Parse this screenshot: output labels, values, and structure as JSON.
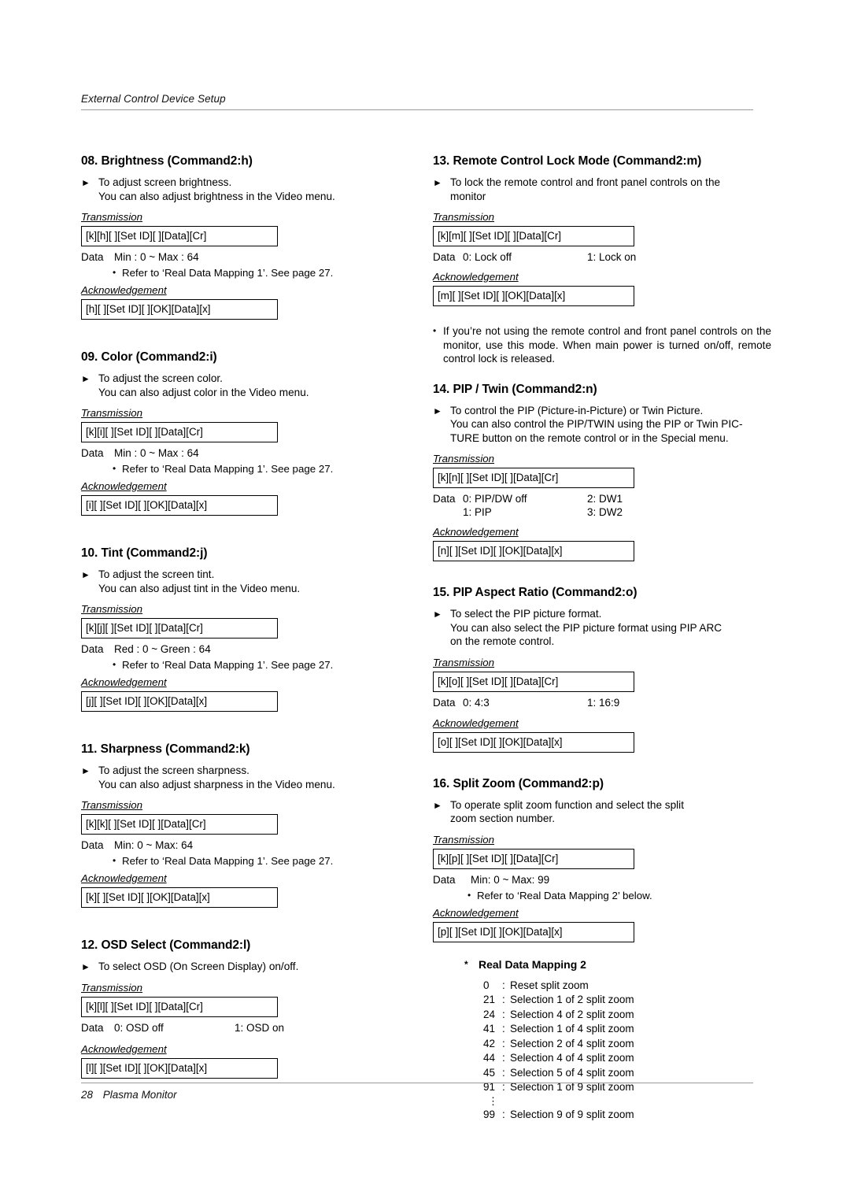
{
  "header": {
    "title": "External Control Device Setup"
  },
  "footer": {
    "page_number": "28",
    "product": "Plasma Monitor"
  },
  "labels": {
    "transmission": "Transmission",
    "acknowledgement": "Acknowledgement",
    "data": "Data",
    "arrow_icon": "black-right-triangle",
    "bullet_icon": "round-bullet",
    "star_icon": "asterisk"
  },
  "left_column": [
    {
      "id": "08",
      "title": "08. Brightness (Command2:h)",
      "desc_lines": [
        "To adjust screen brightness.",
        "You can also adjust brightness in the Video menu."
      ],
      "transmission": "[k][h][  ][Set ID][  ][Data][Cr]",
      "data_label": "Data",
      "data_v1": "Min : 0 ~ Max : 64",
      "data_v2": "",
      "ref": "Refer to ‘Real Data Mapping 1’. See page 27.",
      "acknowledgement": "[h][  ][Set ID][  ][OK][Data][x]"
    },
    {
      "id": "09",
      "title": "09. Color (Command2:i)",
      "desc_lines": [
        "To adjust the screen color.",
        "You can also adjust color in the Video menu."
      ],
      "transmission": "[k][i][  ][Set ID][  ][Data][Cr]",
      "data_label": "Data",
      "data_v1": "Min : 0 ~ Max : 64",
      "data_v2": "",
      "ref": "Refer to ‘Real Data Mapping 1’. See page 27.",
      "acknowledgement": "[i][  ][Set ID][  ][OK][Data][x]"
    },
    {
      "id": "10",
      "title": "10. Tint (Command2:j)",
      "desc_lines": [
        "To adjust the screen tint.",
        "You can also adjust tint in the Video menu."
      ],
      "transmission": "[k][j][  ][Set ID][  ][Data][Cr]",
      "data_label": "Data",
      "data_v1": "Red : 0 ~ Green : 64",
      "data_v2": "",
      "ref": "Refer to ‘Real Data Mapping 1’. See page 27.",
      "acknowledgement": "[j][  ][Set ID][  ][OK][Data][x]"
    },
    {
      "id": "11",
      "title": "11. Sharpness (Command2:k)",
      "desc_lines": [
        "To adjust the screen sharpness.",
        "You can also adjust sharpness in the Video menu."
      ],
      "transmission": "[k][k][  ][Set ID][  ][Data][Cr]",
      "data_label": "Data",
      "data_v1": "Min: 0 ~ Max: 64",
      "data_v2": "",
      "ref": "Refer to ‘Real Data Mapping 1’. See page 27.",
      "acknowledgement": "[k][  ][Set ID][  ][OK][Data][x]"
    },
    {
      "id": "12",
      "title": "12. OSD Select (Command2:l)",
      "desc_lines": [
        "To select OSD (On Screen Display) on/off."
      ],
      "transmission": "[k][l][  ][Set ID][  ][Data][Cr]",
      "data_label": "Data",
      "data_v1": "0: OSD off",
      "data_v2": "1: OSD on",
      "ref": "",
      "acknowledgement": "[l][  ][Set ID][  ][OK][Data][x]"
    }
  ],
  "right_column": [
    {
      "id": "13",
      "title": "13. Remote Control Lock Mode (Command2:m)",
      "desc_lines": [
        "To lock the remote control and front panel controls on the",
        "monitor"
      ],
      "transmission": "[k][m][  ][Set ID][  ][Data][Cr]",
      "data_label": "Data",
      "data_v1": "0: Lock off",
      "data_v2": "1: Lock on",
      "ref": "",
      "acknowledgement": "[m][  ][Set ID][  ][OK][Data][x]",
      "note": "If you’re not using the remote control and front panel controls on the monitor, use this mode. When main power is turned on/off, remote control lock is released."
    },
    {
      "id": "14",
      "title": "14. PIP / Twin (Command2:n)",
      "desc_lines": [
        "To control the PIP (Picture-in-Picture) or Twin Picture.",
        "You can also control the PIP/TWIN using the PIP or Twin PIC-",
        "TURE button on the remote control or in the Special menu."
      ],
      "transmission": "[k][n][  ][Set ID][  ][Data][Cr]",
      "data_label": "Data",
      "data_v1": "0: PIP/DW off",
      "data_v2": "2: DW1",
      "data_v1b": "1: PIP",
      "data_v2b": "3: DW2",
      "ref": "",
      "acknowledgement": "[n][  ][Set ID][  ][OK][Data][x]"
    },
    {
      "id": "15",
      "title": "15. PIP Aspect Ratio (Command2:o)",
      "desc_lines": [
        "To select the PIP picture format.",
        "You can also select the PIP picture format using PIP ARC",
        "on the remote control."
      ],
      "transmission": "[k][o][  ][Set ID][  ][Data][Cr]",
      "data_label": "Data",
      "data_v1": "0: 4:3",
      "data_v2": "1: 16:9",
      "ref": "",
      "acknowledgement": "[o][  ][Set ID][  ][OK][Data][x]"
    },
    {
      "id": "16",
      "title": "16. Split Zoom (Command2:p)",
      "desc_lines": [
        "To operate split zoom function and select the split",
        "zoom section number."
      ],
      "transmission": "[k][p][  ][Set ID][  ][Data][Cr]",
      "data_label": "Data",
      "data_v1": "Min: 0 ~ Max: 99",
      "data_v2": "",
      "ref": "Refer to ‘Real Data Mapping 2’ below.",
      "acknowledgement": "[p][  ][Set ID][  ][OK][Data][x]"
    }
  ],
  "real_data_mapping": {
    "title": "Real Data Mapping 2",
    "items": [
      {
        "key": "0",
        "sep": ":",
        "value": "Reset split zoom"
      },
      {
        "key": "21",
        "sep": ":",
        "value": "Selection 1 of 2 split zoom"
      },
      {
        "key": "24",
        "sep": ":",
        "value": "Selection 4 of 2 split zoom"
      },
      {
        "key": "41",
        "sep": ":",
        "value": "Selection 1 of 4 split zoom"
      },
      {
        "key": "42",
        "sep": ":",
        "value": "Selection 2 of 4 split zoom"
      },
      {
        "key": "44",
        "sep": ":",
        "value": "Selection 4 of 4 split zoom"
      },
      {
        "key": "45",
        "sep": ":",
        "value": "Selection 5 of 4 split zoom"
      },
      {
        "key": "91",
        "sep": ":",
        "value": "Selection 1 of 9 split zoom"
      }
    ],
    "ellipsis": "⋮",
    "last_item": {
      "key": "99",
      "sep": ":",
      "value": "Selection 9 of 9 split zoom"
    }
  }
}
